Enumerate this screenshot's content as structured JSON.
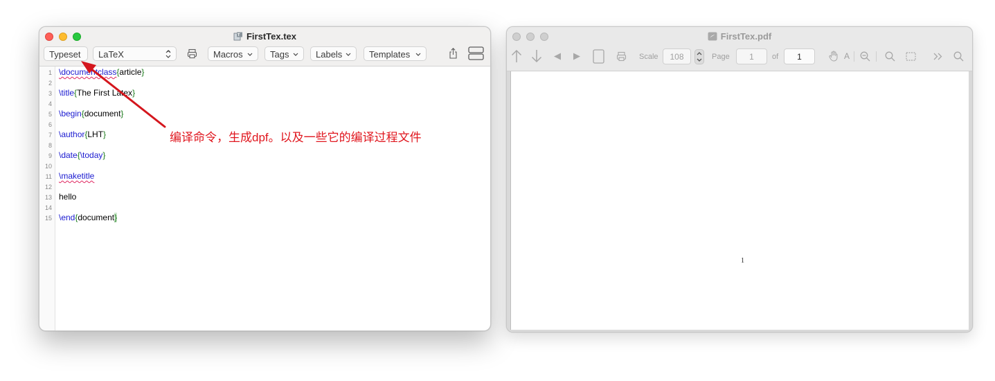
{
  "editor": {
    "title": "FirstTex.tex",
    "toolbar": {
      "typeset_label": "Typeset",
      "engine_value": "LaTeX",
      "macros_label": "Macros",
      "tags_label": "Tags",
      "labels_label": "Labels",
      "templates_label": "Templates"
    },
    "lines": [
      {
        "n": "1"
      },
      {
        "n": "2"
      },
      {
        "n": "3"
      },
      {
        "n": "4"
      },
      {
        "n": "5"
      },
      {
        "n": "6"
      },
      {
        "n": "7"
      },
      {
        "n": "8"
      },
      {
        "n": "9"
      },
      {
        "n": "10"
      },
      {
        "n": "11"
      },
      {
        "n": "12"
      },
      {
        "n": "13"
      },
      {
        "n": "14"
      },
      {
        "n": "15"
      }
    ],
    "code": {
      "l1_cmd": "\\documentclass",
      "l1_arg": "article",
      "l3_cmd": "\\title",
      "l3_arg": "The First Latex",
      "l5_cmd": "\\begin",
      "l5_arg": "document",
      "l7_cmd": "\\author",
      "l7_arg": "LHT",
      "l9_cmd": "\\date",
      "l9_arg": "\\today",
      "l11_cmd": "\\maketitle",
      "l13_text": "hello",
      "l15_cmd": "\\end",
      "l15_arg": "document"
    }
  },
  "pdf": {
    "title": "FirstTex.pdf",
    "scale_label": "Scale",
    "scale_value": "108",
    "page_label": "Page",
    "page_value": "1",
    "of_label": "of",
    "total_pages": "1",
    "page_footer_number": "1"
  },
  "annotation": {
    "text": "编译命令，生成dpf。以及一些它的编译过程文件",
    "color": "#e0161e"
  }
}
